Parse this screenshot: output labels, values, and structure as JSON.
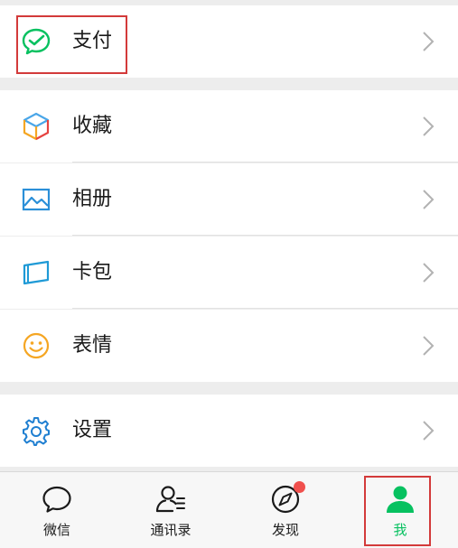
{
  "menu": {
    "pay": {
      "label": "支付",
      "icon": "wechat-pay-icon"
    },
    "favorites": {
      "label": "收藏",
      "icon": "cube-icon"
    },
    "album": {
      "label": "相册",
      "icon": "picture-icon"
    },
    "cards": {
      "label": "卡包",
      "icon": "card-icon"
    },
    "stickers": {
      "label": "表情",
      "icon": "smiley-icon"
    },
    "settings": {
      "label": "设置",
      "icon": "gear-icon"
    }
  },
  "tabbar": {
    "tabs": [
      {
        "label": "微信",
        "icon": "chat-bubble-icon"
      },
      {
        "label": "通讯录",
        "icon": "contacts-icon"
      },
      {
        "label": "发现",
        "icon": "compass-icon",
        "has_dot_badge": true
      },
      {
        "label": "我",
        "icon": "person-icon",
        "active": true
      }
    ]
  },
  "colors": {
    "accent": "#07c160",
    "badge": "#f0504d",
    "highlight_box": "#d33a3a"
  }
}
